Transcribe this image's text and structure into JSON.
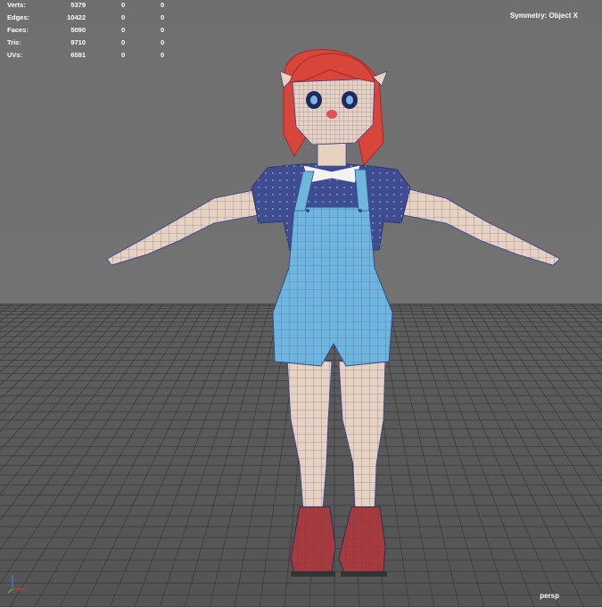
{
  "hud": {
    "stats": [
      {
        "label": "Verts:",
        "value": "5379",
        "selected": "0",
        "triangles": "0"
      },
      {
        "label": "Edges:",
        "value": "10422",
        "selected": "0",
        "triangles": "0"
      },
      {
        "label": "Faces:",
        "value": "5090",
        "selected": "0",
        "triangles": "0"
      },
      {
        "label": "Tris:",
        "value": "9710",
        "selected": "0",
        "triangles": "0"
      },
      {
        "label": "UVs:",
        "value": "6591",
        "selected": "0",
        "triangles": "0"
      }
    ],
    "symmetry": "Symmetry: Object X",
    "camera": "persp"
  },
  "colors": {
    "background_top": "#727272",
    "grid_floor": "#555555",
    "hair": "#d8453a",
    "skin": "#e6d2be",
    "shirt": "#3e4d8f",
    "overalls": "#6fb6de",
    "boots": "#a83a3a",
    "wireframe": "#3a3e9a"
  },
  "icons": {
    "axis": "xyz-axis-icon",
    "model": "character-model-wireframe"
  }
}
